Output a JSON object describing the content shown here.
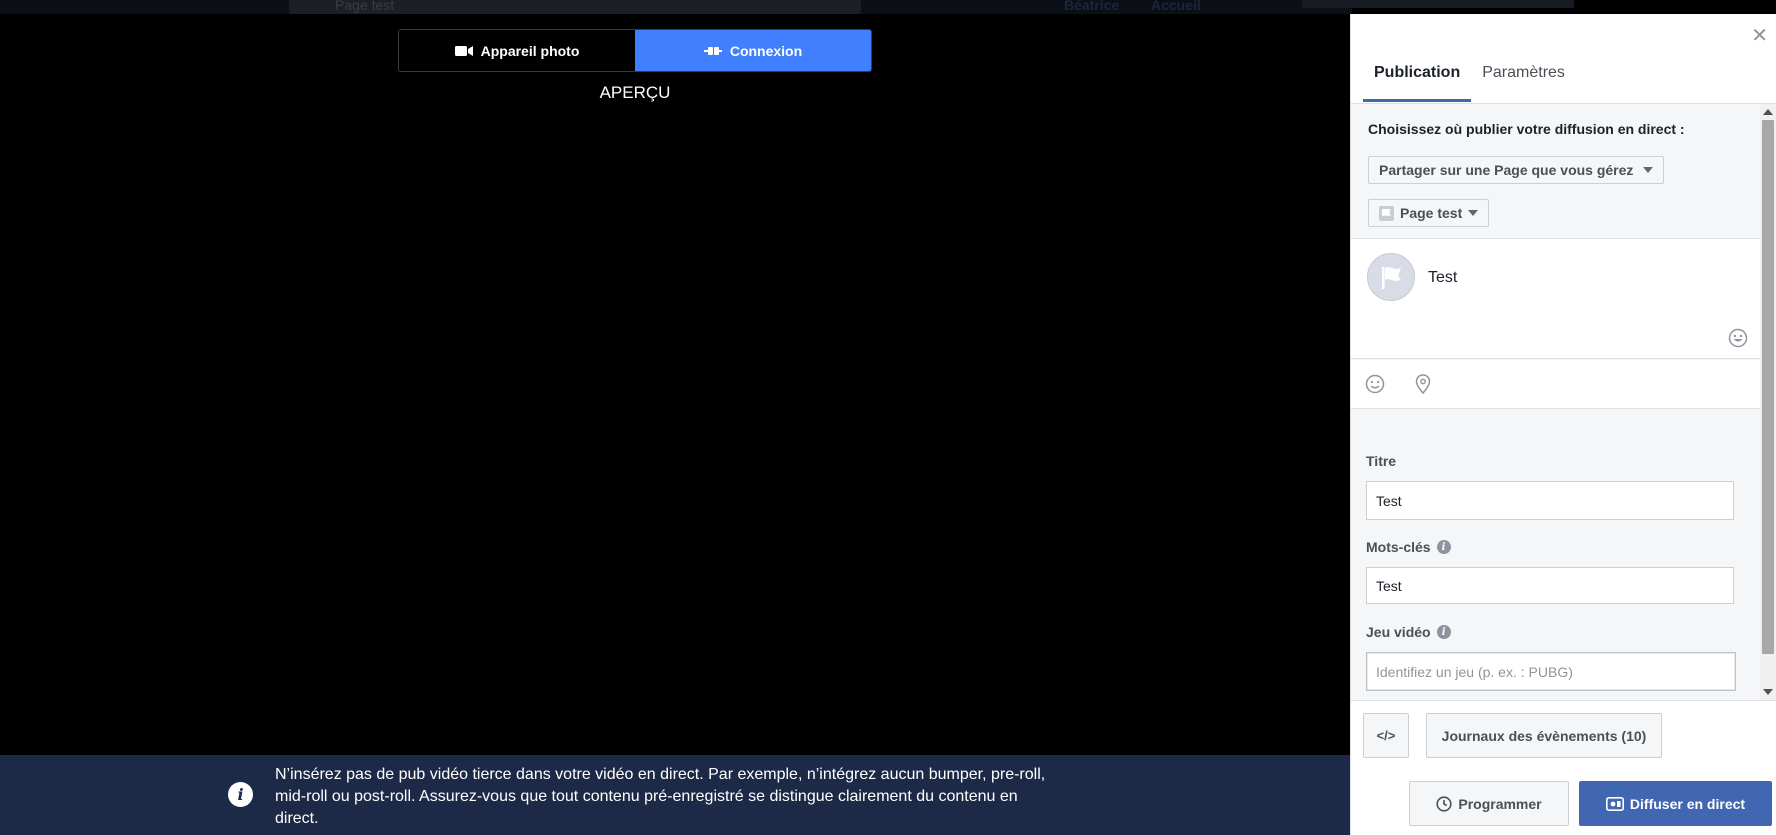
{
  "background": {
    "search_text": "Page test",
    "nav_items": [
      "Béatrice",
      "Accueil"
    ]
  },
  "source_toggle": {
    "camera_label": "Appareil photo",
    "connect_label": "Connexion",
    "selected": "Connexion"
  },
  "preview": {
    "label": "APERÇU"
  },
  "banner": {
    "icon": "info-icon",
    "text": "N’insérez pas de pub vidéo tierce dans votre vidéo en direct. Par exemple, n’intégrez aucun bumper, pre-roll, mid-roll ou post-roll. Assurez-vous que tout contenu pré-enregistré se distingue clairement du contenu en direct."
  },
  "panel": {
    "close_icon": "close-icon",
    "tabs": [
      {
        "label": "Publication",
        "active": true
      },
      {
        "label": "Paramètres",
        "active": false
      }
    ],
    "publish_prompt": "Choisissez où publier votre diffusion en direct :",
    "share_dropdown": "Partager sur une Page que vous gérez",
    "page_dropdown": "Page test",
    "composer": {
      "text": "Test",
      "tools": [
        "emoji-icon",
        "location-pin-icon"
      ]
    },
    "title": {
      "label": "Titre",
      "value": "Test"
    },
    "keywords": {
      "label": "Mots-clés",
      "value": "Test"
    },
    "game": {
      "label": "Jeu vidéo",
      "placeholder": "Identifiez un jeu (p. ex. : PUBG)"
    },
    "footer": {
      "code_label": "</>",
      "log_label": "Journaux des évènements (10)",
      "schedule_label": "Programmer",
      "golive_label": "Diffuser en direct"
    }
  },
  "colors": {
    "accent": "#4080ff",
    "brand_blue": "#4267b2",
    "banner_bg": "#1c2a47"
  }
}
